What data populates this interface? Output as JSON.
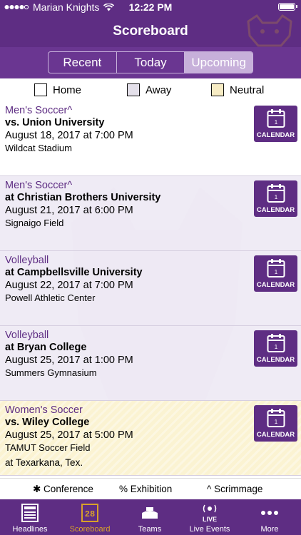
{
  "status": {
    "carrier": "Marian Knights",
    "time": "12:22 PM"
  },
  "nav": {
    "title": "Scoreboard"
  },
  "segments": [
    {
      "label": "Recent",
      "active": false
    },
    {
      "label": "Today",
      "active": false
    },
    {
      "label": "Upcoming",
      "active": true
    }
  ],
  "legend": {
    "home": "Home",
    "away": "Away",
    "neutral": "Neutral",
    "colors": {
      "home": "#ffffff",
      "away": "#e4e0ea",
      "neutral": "#f7ecc4"
    }
  },
  "games": [
    {
      "sport": "Men's Soccer^",
      "opponent": "vs. Union University",
      "datetime": "August 18, 2017 at 7:00 PM",
      "venue": "Wildcat Stadium",
      "city": "",
      "type": "home",
      "calendar_label": "CALENDAR",
      "calendar_day": "1"
    },
    {
      "sport": "Men's Soccer^",
      "opponent": "at Christian Brothers University",
      "datetime": "August 21, 2017 at 6:00 PM",
      "venue": "Signaigo Field",
      "city": "",
      "type": "away",
      "calendar_label": "CALENDAR",
      "calendar_day": "1"
    },
    {
      "sport": "Volleyball",
      "opponent": "at Campbellsville University",
      "datetime": "August 22, 2017 at 7:00 PM",
      "venue": "Powell Athletic Center",
      "city": "",
      "type": "away",
      "calendar_label": "CALENDAR",
      "calendar_day": "1"
    },
    {
      "sport": "Volleyball",
      "opponent": "at Bryan College",
      "datetime": "August 25, 2017 at 1:00 PM",
      "venue": "Summers Gymnasium",
      "city": "",
      "type": "away",
      "calendar_label": "CALENDAR",
      "calendar_day": "1"
    },
    {
      "sport": "Women's Soccer",
      "opponent": "vs. Wiley College",
      "datetime": "August 25, 2017 at 5:00 PM",
      "venue": "TAMUT Soccer Field",
      "city": "at Texarkana, Tex.",
      "type": "neutral",
      "calendar_label": "CALENDAR",
      "calendar_day": "1"
    }
  ],
  "footer_legend": {
    "conference": "✱ Conference",
    "exhibition": "% Exhibition",
    "scrimmage": "^  Scrimmage"
  },
  "tabs": [
    {
      "label": "Headlines",
      "icon": "newspaper-icon",
      "active": false
    },
    {
      "label": "Scoreboard",
      "icon": "scoreboard-icon",
      "active": true
    },
    {
      "label": "Teams",
      "icon": "stadium-icon",
      "active": false
    },
    {
      "label": "Live Events",
      "icon": "live-icon",
      "active": false
    },
    {
      "label": "More",
      "icon": "more-icon",
      "active": false
    }
  ],
  "colors": {
    "brand": "#5e2d83",
    "active_tab": "#d8a12a",
    "sport_text": "#5e2d83"
  }
}
